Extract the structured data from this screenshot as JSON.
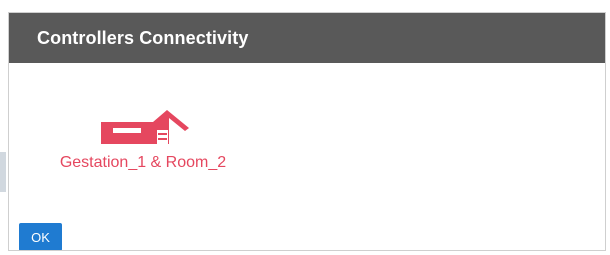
{
  "dialog": {
    "title": "Controllers Connectivity",
    "controllers": [
      {
        "label": "Gestation_1 & Room_2",
        "icon": "barn-icon",
        "color": "#e5475f"
      }
    ],
    "ok_label": "OK"
  },
  "colors": {
    "titlebar": "#595959",
    "accent": "#e5475f",
    "button": "#1f7bd1"
  }
}
